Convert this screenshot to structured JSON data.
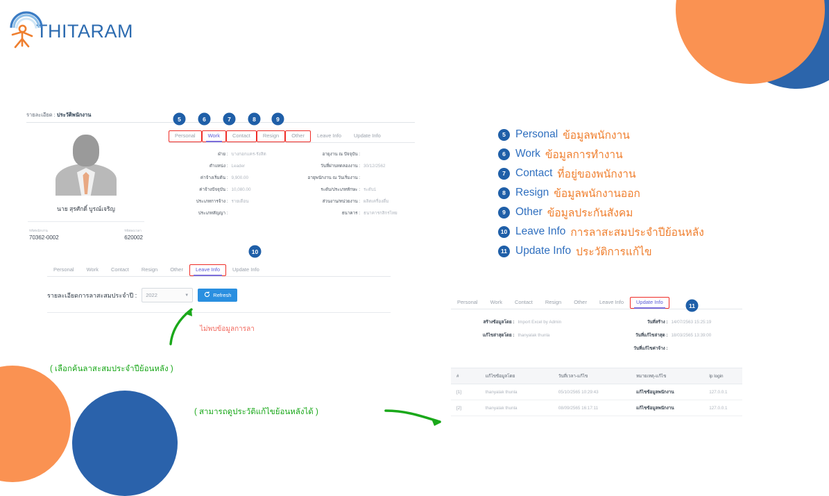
{
  "brand": {
    "name": "THITARAM",
    "blue": "#2c6bb0",
    "orange": "#ef7f2f"
  },
  "breadcrumb": {
    "prefix": "รายละเอียด :",
    "page": "ประวัติพนักงาน"
  },
  "employee": {
    "name": "นาย สุรศักดิ์ บูรณ์เจริญ",
    "code_label": "รหัสพนักงาน",
    "code_value": "70362-0002",
    "time_code_label": "รหัสลงเวลา",
    "time_code_value": "620002"
  },
  "tabs_top": [
    {
      "label": "Personal",
      "active": false,
      "highlight": true,
      "badge": "5"
    },
    {
      "label": "Work",
      "active": true,
      "highlight": true,
      "badge": "6"
    },
    {
      "label": "Contact",
      "active": false,
      "highlight": true,
      "badge": "7"
    },
    {
      "label": "Resign",
      "active": false,
      "highlight": true,
      "badge": "8"
    },
    {
      "label": "Other",
      "active": false,
      "highlight": true,
      "badge": "9"
    },
    {
      "label": "Leave Info",
      "active": false,
      "highlight": false,
      "badge": ""
    },
    {
      "label": "Update Info",
      "active": false,
      "highlight": false,
      "badge": ""
    }
  ],
  "work_fields_left": [
    {
      "label": "ฝ่าย :",
      "value": "บางกอกแคร-รังสิต"
    },
    {
      "label": "ตำแหน่ง :",
      "value": "Leader"
    },
    {
      "label": "ค่าจ้างเริ่มต้น :",
      "value": "9,900.00"
    },
    {
      "label": "ค่าจ้างปัจจุบัน :",
      "value": "10,080.00"
    },
    {
      "label": "ประเภทการจ้าง :",
      "value": "รายเดือน"
    },
    {
      "label": "ประเภทสัญญา :",
      "value": ""
    }
  ],
  "work_fields_right": [
    {
      "label": "อายุงาน ณ ปัจจุบัน :",
      "value": ""
    },
    {
      "label": "วันที่ผ่านทดลองงาน :",
      "value": "30/12/2562"
    },
    {
      "label": "อายุพนักงาน ณ วันเริ่มงาน :",
      "value": ""
    },
    {
      "label": "ระดับ/ประเภททักษะ :",
      "value": "ระดับ1"
    },
    {
      "label": "ส่วนงาน/หน่วยงาน :",
      "value": "ผลิตเครื่องดื่ม"
    },
    {
      "label": "ธนาคาร :",
      "value": "ธนาคารกสิกรไทย"
    }
  ],
  "tabs_leave": [
    {
      "label": "Personal",
      "active": false,
      "highlight": false
    },
    {
      "label": "Work",
      "active": false,
      "highlight": false
    },
    {
      "label": "Contact",
      "active": false,
      "highlight": false
    },
    {
      "label": "Resign",
      "active": false,
      "highlight": false
    },
    {
      "label": "Other",
      "active": false,
      "highlight": false
    },
    {
      "label": "Leave Info",
      "active": true,
      "highlight": true
    },
    {
      "label": "Update Info",
      "active": false,
      "highlight": false
    }
  ],
  "leave_badge": "10",
  "leave": {
    "label": "รายละเอียดการลาสะสมประจำปี  :",
    "year_value": "2022",
    "refresh_label": "Refresh",
    "refresh_icon": "refresh-icon",
    "no_data": "ไม่พบข้อมูลการลา"
  },
  "annotations": {
    "leave_note": "( เลือกค้นลาสะสมประจำปีย้อนหลัง )",
    "history_note": "( สามารถดูประวัติแก้ไขย้อนหลังได้ )"
  },
  "legend": [
    {
      "num": "5",
      "en": "Personal",
      "th": "ข้อมูลพนักงาน"
    },
    {
      "num": "6",
      "en": "Work",
      "th": "ข้อมูลการทำงาน"
    },
    {
      "num": "7",
      "en": "Contact",
      "th": "ที่อยู่ของพนักงาน"
    },
    {
      "num": "8",
      "en": "Resign",
      "th": "ข้อมูลพนักงานออก"
    },
    {
      "num": "9",
      "en": "Other",
      "th": "ข้อมูลประกันสังคม"
    },
    {
      "num": "10",
      "en": "Leave Info",
      "th": "การลาสะสมประจำปีย้อนหลัง"
    },
    {
      "num": "11",
      "en": "Update Info",
      "th": "ประวัติการแก้ไข"
    }
  ],
  "tabs_update": [
    {
      "label": "Personal",
      "active": false,
      "highlight": false
    },
    {
      "label": "Work",
      "active": false,
      "highlight": false
    },
    {
      "label": "Contact",
      "active": false,
      "highlight": false
    },
    {
      "label": "Resign",
      "active": false,
      "highlight": false
    },
    {
      "label": "Other",
      "active": false,
      "highlight": false
    },
    {
      "label": "Leave Info",
      "active": false,
      "highlight": false
    },
    {
      "label": "Update Info",
      "active": true,
      "highlight": true
    }
  ],
  "update_badge": "11",
  "update_fields_left": [
    {
      "label": "สร้างข้อมูลโดย :",
      "value": "Import Excel by Admin"
    },
    {
      "label": "แก้ไขล่าสุดโดย :",
      "value": "thanyalak thunla"
    }
  ],
  "update_fields_right": [
    {
      "label": "วันที่สร้าง :",
      "value": "14/07/2563 15:25:19"
    },
    {
      "label": "วันที่แก้ไขล่าสุด :",
      "value": "18/03/2565 13:39:00"
    },
    {
      "label": "วันที่แก้ไขค่าจ้าง :",
      "value": ""
    }
  ],
  "history_table": {
    "columns": [
      "#",
      "แก้ไขข้อมูลโดย",
      "วันที่เวลา-แก้ไข",
      "หมายเหตุ-แก้ไข",
      "Ip login"
    ],
    "rows": [
      {
        "idx": "[1]",
        "by": "thanyalak thunla",
        "datetime": "05/10/2565 10:29:43",
        "note": "แก้ไขข้อมูลพนักงาน",
        "ip": "127.0.0.1"
      },
      {
        "idx": "[2]",
        "by": "thanyalak thunla",
        "datetime": "08/09/2565 16:17:11",
        "note": "แก้ไขข้อมูลพนักงาน",
        "ip": "127.0.0.1"
      }
    ]
  }
}
